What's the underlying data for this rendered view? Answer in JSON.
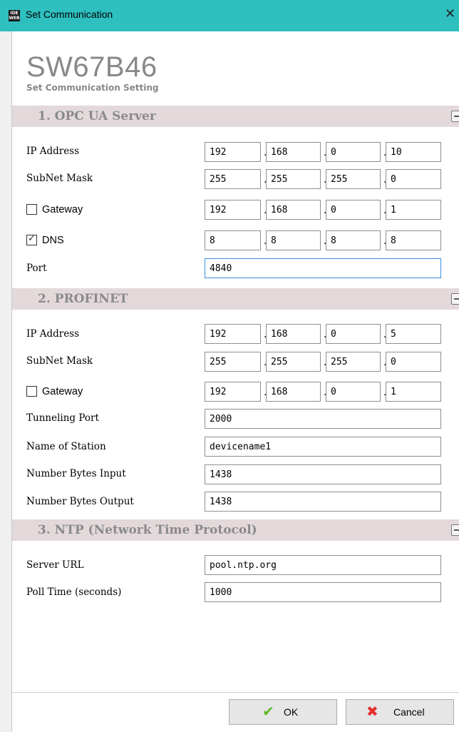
{
  "window": {
    "title": "Set Communication",
    "icon_text": "IDE WEB"
  },
  "header": {
    "product_code": "SW67B46",
    "subtitle": "Set Communication Setting"
  },
  "sections": {
    "opcua": {
      "title": "1. OPC UA Server",
      "ip_label": "IP Address",
      "ip": [
        "192",
        "168",
        "0",
        "10"
      ],
      "mask_label": "SubNet Mask",
      "mask": [
        "255",
        "255",
        "255",
        "0"
      ],
      "gateway_label": "Gateway",
      "gateway_checked": false,
      "gateway": [
        "192",
        "168",
        "0",
        "1"
      ],
      "dns_label": "DNS",
      "dns_checked": true,
      "dns": [
        "8",
        "8",
        "8",
        "8"
      ],
      "port_label": "Port",
      "port": "4840"
    },
    "profinet": {
      "title": "2. PROFINET",
      "ip_label": "IP Address",
      "ip": [
        "192",
        "168",
        "0",
        "5"
      ],
      "mask_label": "SubNet Mask",
      "mask": [
        "255",
        "255",
        "255",
        "0"
      ],
      "gateway_label": "Gateway",
      "gateway_checked": false,
      "gateway": [
        "192",
        "168",
        "0",
        "1"
      ],
      "tunnel_label": "Tunneling Port",
      "tunnel": "2000",
      "station_label": "Name of Station",
      "station": "devicename1",
      "bytes_in_label": "Number Bytes Input",
      "bytes_in": "1438",
      "bytes_out_label": "Number Bytes Output",
      "bytes_out": "1438"
    },
    "ntp": {
      "title": "3. NTP (Network Time Protocol)",
      "server_label": "Server URL",
      "server": "pool.ntp.org",
      "poll_label": "Poll Time (seconds)",
      "poll": "1000"
    }
  },
  "buttons": {
    "ok": "OK",
    "cancel": "Cancel"
  },
  "colors": {
    "titlebar": "#2ebfbf",
    "section_header": "#e3d9da",
    "ok_icon": "#5cb82a",
    "cancel_icon": "#e53030"
  }
}
